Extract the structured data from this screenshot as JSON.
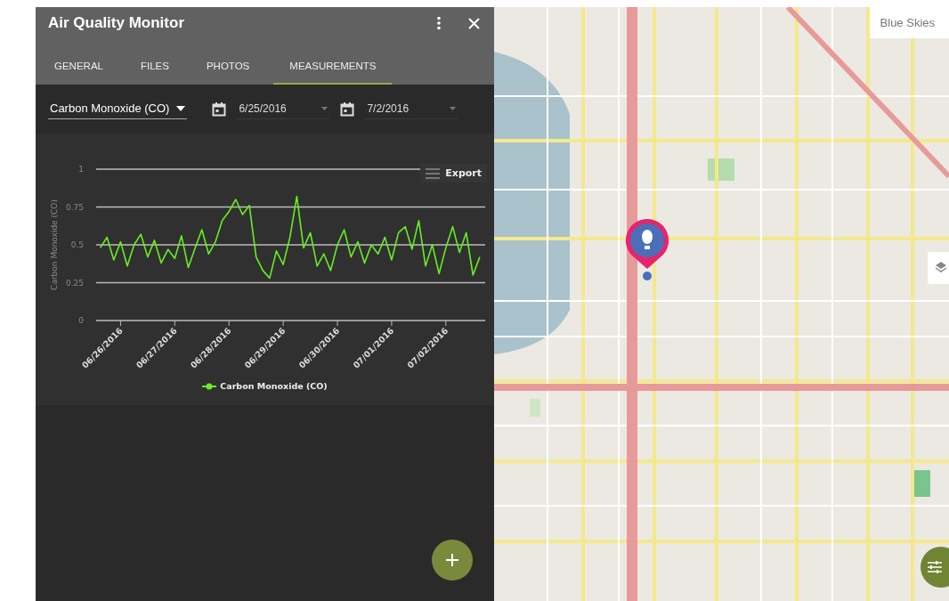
{
  "panel": {
    "title": "Air Quality Monitor",
    "tabs": [
      {
        "label": "GENERAL",
        "selected": false
      },
      {
        "label": "FILES",
        "selected": false
      },
      {
        "label": "PHOTOS",
        "selected": false
      },
      {
        "label": "MEASUREMENTS",
        "selected": true
      }
    ],
    "pollutant": {
      "value": "Carbon Monoxide (CO)"
    },
    "start_date": {
      "value": "6/25/2016"
    },
    "end_date": {
      "value": "7/2/2016"
    },
    "export_label": "Export",
    "chart_data": {
      "type": "line",
      "ylabel": "Carbon Monoxide (CO)",
      "ylim": [
        0,
        1
      ],
      "yticks": [
        0,
        0.25,
        0.5,
        0.75,
        1
      ],
      "grid": true,
      "categories": [
        null,
        null,
        null,
        "06/26/2016",
        null,
        null,
        null,
        null,
        null,
        null,
        null,
        "06/27/2016",
        null,
        null,
        null,
        null,
        null,
        null,
        null,
        "06/28/2016",
        null,
        null,
        null,
        null,
        null,
        null,
        null,
        "06/29/2016",
        null,
        null,
        null,
        null,
        null,
        null,
        null,
        "06/30/2016",
        null,
        null,
        null,
        null,
        null,
        null,
        null,
        "07/01/2016",
        null,
        null,
        null,
        null,
        null,
        null,
        null,
        "07/02/2016",
        null,
        null,
        null,
        null,
        null
      ],
      "series": [
        {
          "name": "Carbon Monoxide (CO)",
          "color": "#66ee22",
          "values": [
            0.48,
            0.55,
            0.4,
            0.52,
            0.36,
            0.5,
            0.57,
            0.42,
            0.53,
            0.38,
            0.47,
            0.41,
            0.56,
            0.35,
            0.48,
            0.6,
            0.44,
            0.52,
            0.66,
            0.72,
            0.8,
            0.7,
            0.76,
            0.42,
            0.33,
            0.28,
            0.46,
            0.37,
            0.55,
            0.82,
            0.48,
            0.58,
            0.36,
            0.44,
            0.33,
            0.5,
            0.6,
            0.42,
            0.52,
            0.38,
            0.5,
            0.44,
            0.55,
            0.4,
            0.58,
            0.62,
            0.47,
            0.66,
            0.36,
            0.5,
            0.31,
            0.48,
            0.62,
            0.45,
            0.58,
            0.3,
            0.42
          ]
        }
      ]
    }
  },
  "map": {
    "label": "Blue Skies"
  }
}
